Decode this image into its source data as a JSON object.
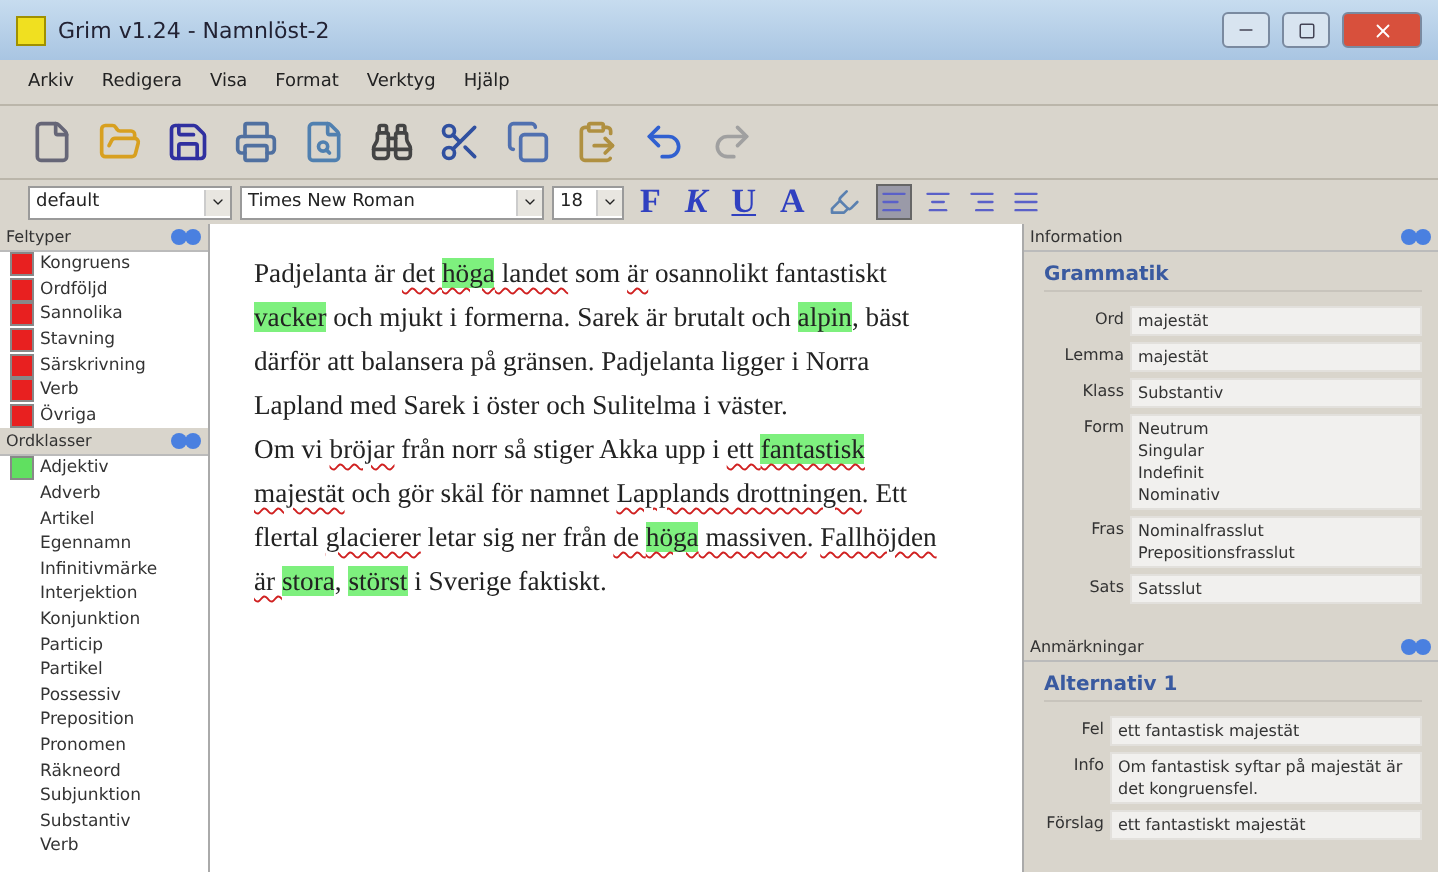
{
  "window": {
    "title": "Grim v1.24 - Namnlöst-2"
  },
  "menu": [
    "Arkiv",
    "Redigera",
    "Visa",
    "Format",
    "Verktyg",
    "Hjälp"
  ],
  "toolbar": [
    {
      "kind": "new",
      "disabled": false
    },
    {
      "kind": "open",
      "disabled": false
    },
    {
      "kind": "save",
      "disabled": false
    },
    {
      "kind": "print",
      "disabled": false
    },
    {
      "kind": "preview",
      "disabled": false
    },
    {
      "kind": "find",
      "disabled": false
    },
    {
      "kind": "cut",
      "disabled": false
    },
    {
      "kind": "copy",
      "disabled": false
    },
    {
      "kind": "paste",
      "disabled": false
    },
    {
      "kind": "undo",
      "disabled": false
    },
    {
      "kind": "redo",
      "disabled": true
    }
  ],
  "format_bar": {
    "style": "default",
    "font": "Times New Roman",
    "size": "18",
    "text_buttons": [
      {
        "label": "F",
        "kind": "bold"
      },
      {
        "label": "K",
        "kind": "italic"
      },
      {
        "label": "U",
        "kind": "underline"
      },
      {
        "label": "A",
        "kind": "color"
      }
    ],
    "align": [
      {
        "kind": "left",
        "selected": true
      },
      {
        "kind": "center",
        "selected": false
      },
      {
        "kind": "right",
        "selected": false
      },
      {
        "kind": "justify",
        "selected": false
      }
    ]
  },
  "sidebar": [
    {
      "title": "Feltyper",
      "items": [
        {
          "label": "Kongruens",
          "color": "#e82020"
        },
        {
          "label": "Ordföljd",
          "color": "#e82020"
        },
        {
          "label": "Sannolika",
          "color": "#e82020"
        },
        {
          "label": "Stavning",
          "color": "#e82020"
        },
        {
          "label": "Särskrivning",
          "color": "#e82020"
        },
        {
          "label": "Verb",
          "color": "#e82020"
        },
        {
          "label": "Övriga",
          "color": "#e82020"
        }
      ]
    },
    {
      "title": "Ordklasser",
      "items": [
        {
          "label": "Adjektiv",
          "color": "#60e060"
        },
        {
          "label": "Adverb"
        },
        {
          "label": "Artikel"
        },
        {
          "label": "Egennamn"
        },
        {
          "label": "Infinitivmärke"
        },
        {
          "label": "Interjektion"
        },
        {
          "label": "Konjunktion"
        },
        {
          "label": "Particip"
        },
        {
          "label": "Partikel"
        },
        {
          "label": "Possessiv"
        },
        {
          "label": "Preposition"
        },
        {
          "label": "Pronomen"
        },
        {
          "label": "Räkneord"
        },
        {
          "label": "Subjunktion"
        },
        {
          "label": "Substantiv"
        },
        {
          "label": "Verb"
        }
      ]
    }
  ],
  "document": [
    [
      {
        "text": "Padjelanta är ",
        "highlight": false,
        "error": false
      },
      {
        "text": "det ",
        "highlight": false,
        "error": true
      },
      {
        "text": "höga",
        "highlight": true,
        "error": true
      },
      {
        "text": " landet",
        "highlight": false,
        "error": true
      },
      {
        "text": " som ",
        "highlight": false,
        "error": false
      },
      {
        "text": "är",
        "highlight": false,
        "error": true
      },
      {
        "text": " osannolikt fantastiskt ",
        "highlight": false,
        "error": false
      },
      {
        "text": "vacker",
        "highlight": true,
        "error": false
      },
      {
        "text": " och mjukt i formerna. Sarek är brutalt och ",
        "highlight": false,
        "error": false
      },
      {
        "text": "alpin",
        "highlight": true,
        "error": false
      },
      {
        "text": ", bäst därför att balansera på gränsen. Padjelanta ligger i Norra Lapland med Sarek i öster och Sulitelma i väster.",
        "highlight": false,
        "error": false
      }
    ],
    [
      {
        "text": "Om vi ",
        "highlight": false,
        "error": false
      },
      {
        "text": "bröjar",
        "highlight": false,
        "error": true
      },
      {
        "text": " från norr så stiger Akka upp i ",
        "highlight": false,
        "error": false
      },
      {
        "text": "ett ",
        "highlight": false,
        "error": true
      },
      {
        "text": "fantastisk",
        "highlight": true,
        "error": true
      },
      {
        "text": " majestät",
        "highlight": false,
        "error": true
      },
      {
        "text": " och gör skäl för namnet ",
        "highlight": false,
        "error": false
      },
      {
        "text": "Lapplands drottningen",
        "highlight": false,
        "error": true
      },
      {
        "text": ". Ett flertal ",
        "highlight": false,
        "error": false
      },
      {
        "text": "glacierer",
        "highlight": false,
        "error": true
      },
      {
        "text": " letar sig ner från ",
        "highlight": false,
        "error": false
      },
      {
        "text": "de ",
        "highlight": false,
        "error": true
      },
      {
        "text": "höga",
        "highlight": true,
        "error": true
      },
      {
        "text": " massiven",
        "highlight": false,
        "error": true
      },
      {
        "text": ". ",
        "highlight": false,
        "error": false
      },
      {
        "text": "Fallhöjden är ",
        "highlight": false,
        "error": true
      },
      {
        "text": "stora",
        "highlight": true,
        "error": false
      },
      {
        "text": ", ",
        "highlight": false,
        "error": false
      },
      {
        "text": "störst",
        "highlight": true,
        "error": false
      },
      {
        "text": " i Sverige faktiskt.",
        "highlight": false,
        "error": false
      }
    ]
  ],
  "panels": [
    {
      "title": "Information",
      "group": "Grammatik",
      "fields": [
        {
          "label": "Ord",
          "lines": [
            "majestät"
          ]
        },
        {
          "label": "Lemma",
          "lines": [
            "majestät"
          ]
        },
        {
          "label": "Klass",
          "lines": [
            "Substantiv"
          ]
        },
        {
          "label": "Form",
          "lines": [
            "Neutrum",
            "Singular",
            "Indefinit",
            "Nominativ"
          ]
        },
        {
          "label": "Fras",
          "lines": [
            "Nominalfrasslut",
            "Prepositionsfrasslut"
          ]
        },
        {
          "label": "Sats",
          "lines": [
            "Satsslut"
          ]
        }
      ]
    },
    {
      "title": "Anmärkningar",
      "group": "Alternativ 1",
      "fields": [
        {
          "label": "Fel",
          "lines": [
            "ett fantastisk majestät"
          ]
        },
        {
          "label": "Info",
          "lines": [
            "Om fantastisk syftar på majestät är det kongruensfel."
          ]
        },
        {
          "label": "Förslag",
          "lines": [
            "ett fantastiskt majestät"
          ]
        }
      ]
    }
  ]
}
